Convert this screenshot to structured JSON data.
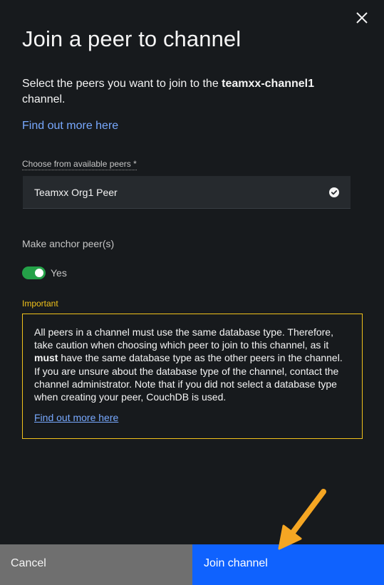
{
  "dialog": {
    "title": "Join a peer to channel",
    "desc_prefix": "Select the peers you want to join to the ",
    "channel_name": "teamxx-channel1",
    "desc_suffix": " channel.",
    "find_out_link": "Find out more here"
  },
  "peers_field": {
    "label": "Choose from available peers *",
    "selected_value": "Teamxx Org1 Peer"
  },
  "anchor": {
    "label": "Make anchor peer(s)",
    "toggle_text": "Yes"
  },
  "important": {
    "label": "Important",
    "text_part1": "All peers in a channel must use the same database type. Therefore, take caution when choosing which peer to join to this channel, as it ",
    "text_bold": "must",
    "text_part2": " have the same database type as the other peers in the channel. If you are unsure about the database type of the channel, contact the channel administrator. Note that if you did not select a database type when creating your peer, CouchDB is used.",
    "link": "Find out more here"
  },
  "footer": {
    "cancel_label": "Cancel",
    "join_label": "Join channel"
  },
  "colors": {
    "background": "#171a1d",
    "link": "#78a9ff",
    "warning": "#f1c21b",
    "toggle_on": "#24a148",
    "primary_button": "#0f62fe",
    "secondary_button": "#6f6f6f",
    "annotation_arrow": "#f5a623"
  },
  "icons": {
    "close": "close-icon",
    "selected": "checkmark-filled-icon",
    "annotation": "arrow-annotation-icon"
  }
}
